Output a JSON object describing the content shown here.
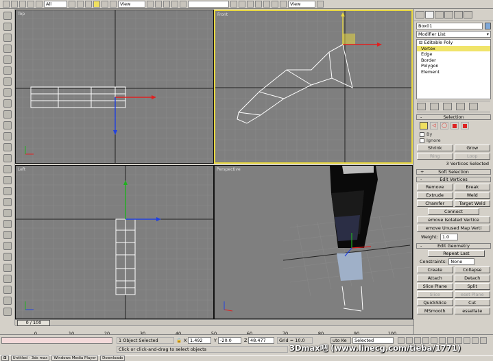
{
  "toolbar": {
    "selection_filter": "All",
    "ref_coord_1": "View",
    "ref_coord_2": "View",
    "icons": [
      "undo-icon",
      "redo-icon",
      "select-link-icon",
      "unlink-icon",
      "bind-icon",
      "select-icon",
      "select-by-name-icon",
      "region-select-icon",
      "move-icon",
      "rotate-icon",
      "scale-icon",
      "mirror-icon",
      "align-icon",
      "material-editor-icon",
      "render-icon",
      "quick-render-icon"
    ]
  },
  "viewports": {
    "top": {
      "label": "Top"
    },
    "front": {
      "label": "Front"
    },
    "left": {
      "label": "Left"
    },
    "perspective": {
      "label": "Perspective"
    }
  },
  "panel": {
    "object_name": "Box01",
    "modifier_list": "Modifier List",
    "stack": {
      "root": "Editable Poly",
      "items": [
        "Vertex",
        "Edge",
        "Border",
        "Polygon",
        "Element"
      ],
      "selected": "Vertex"
    },
    "selection": {
      "title": "Selection",
      "by_label": "By",
      "ignore_label": "Ignore",
      "shrink": "Shrink",
      "grow": "Grow",
      "ring": "Ring",
      "loop": "Loop",
      "status": "3 Vertices Selected"
    },
    "soft_selection": {
      "title": "Soft Selection"
    },
    "edit_vertices": {
      "title": "Edit Vertices",
      "remove": "Remove",
      "break": "Break",
      "extrude": "Extrude",
      "weld": "Weld",
      "chamfer": "Chamfer",
      "target_weld": "Target Weld",
      "connect": "Connect",
      "remove_isolated": "emove Isolated Vertice",
      "remove_unused": "emove Unused Map Verti",
      "weight_label": "Weight:",
      "weight_value": "1.0"
    },
    "edit_geometry": {
      "title": "Edit Geometry",
      "repeat_last": "Repeat Last",
      "constraints_label": "Constraints:",
      "constraints_value": "None",
      "create": "Create",
      "collapse": "Collapse",
      "attach": "Attach",
      "detach": "Detach",
      "slice_plane": "Slice Plane",
      "split": "Split",
      "slice": "Slice",
      "reset_plane": "eset Plane",
      "quickslice": "QuickSlice",
      "cut": "Cut",
      "msmooth": "MSmooth",
      "tessellate": "essellate"
    }
  },
  "timeline": {
    "slider_text": "0 / 100",
    "ticks": [
      "0",
      "10",
      "20",
      "30",
      "40",
      "50",
      "60",
      "70",
      "80",
      "90",
      "100"
    ]
  },
  "status": {
    "objects_selected": "1 Object Selected",
    "prompt": "Click or click-and-drag to select objects",
    "x_label": "X",
    "x_value": "1.492",
    "y_label": "Y",
    "y_value": "-20.0",
    "z_label": "Z",
    "z_value": "48.477",
    "grid": "Grid = 10.0",
    "auto_key": "uto Ke",
    "key_filter": "Selected"
  },
  "taskbar": {
    "items": [
      "Untitled - 3ds max",
      "Windows Media Player",
      "Downloads"
    ]
  },
  "watermark": "3Dmax吧 (www.linecg.com/tieba/1771)",
  "colors": {
    "viewport_bg": "#7f7f7f",
    "active_border": "#e8d740",
    "selected_stack": "#f0e46a",
    "x_axis": "#e02020",
    "y_axis": "#20b020",
    "z_axis": "#2040e0"
  }
}
